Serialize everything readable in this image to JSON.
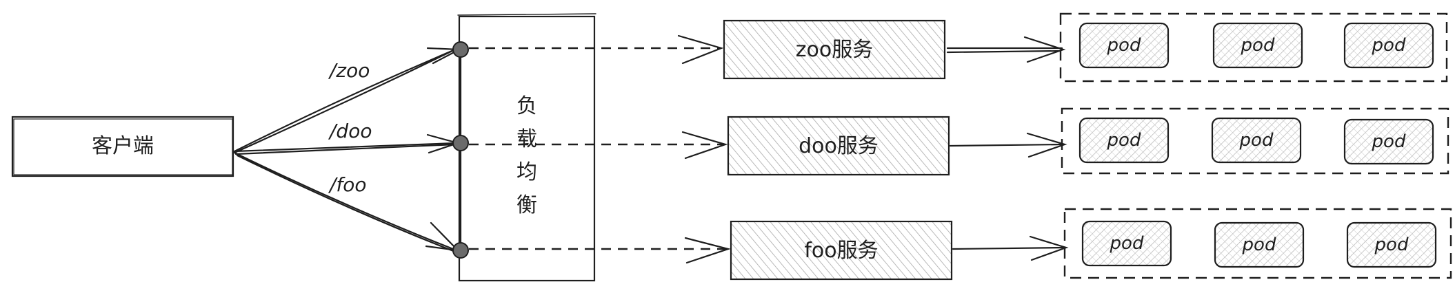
{
  "client": {
    "label": "客户端"
  },
  "load_balancer": {
    "chars": [
      "负",
      "载",
      "均",
      "衡"
    ]
  },
  "routes": [
    {
      "path": "/zoo",
      "service": "zoo服务",
      "pods": [
        "pod",
        "pod",
        "pod"
      ]
    },
    {
      "path": "/doo",
      "service": "doo服务",
      "pods": [
        "pod",
        "pod",
        "pod"
      ]
    },
    {
      "path": "/foo",
      "service": "foo服务",
      "pods": [
        "pod",
        "pod",
        "pod"
      ]
    }
  ],
  "colors": {
    "stroke": "#1e1e1e",
    "node_fill": "#6b6b6b",
    "hatch": "#9a9a9a",
    "background": "#ffffff"
  }
}
